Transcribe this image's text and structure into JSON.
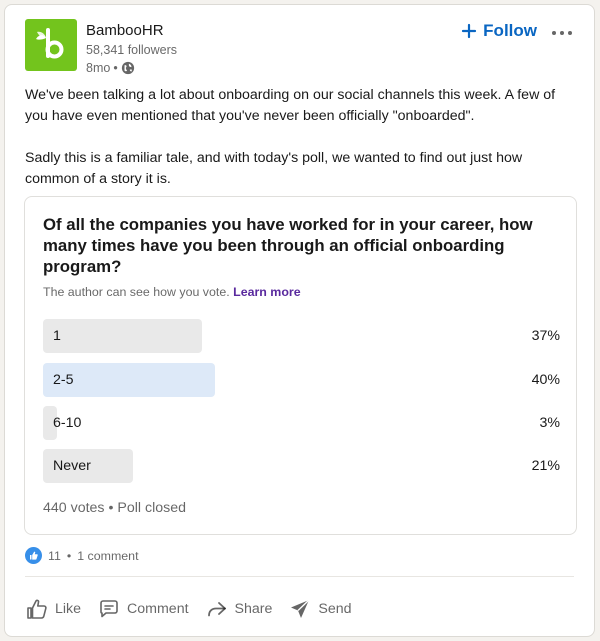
{
  "post": {
    "author_name": "BambooHR",
    "followers": "58,341 followers",
    "time": "8mo",
    "visibility_separator": "•",
    "follow_label": "Follow",
    "body": [
      "We've been talking a lot about onboarding on our social channels this week. A few of you have even mentioned that you've never been officially \"onboarded\".",
      "Sadly this is a familiar tale, and with today's poll, we wanted to find out just how common of a story it is."
    ]
  },
  "poll": {
    "question": "Of all the companies you have worked for in your career, how many times have you been through an official onboarding program?",
    "note": "The author can see how you vote.",
    "learn_more": "Learn more",
    "options": [
      {
        "label": "1",
        "percent_label": "37%",
        "percent": 37,
        "selected": false
      },
      {
        "label": "2-5",
        "percent_label": "40%",
        "percent": 40,
        "selected": true
      },
      {
        "label": "6-10",
        "percent_label": "3%",
        "percent": 3,
        "selected": false
      },
      {
        "label": "Never",
        "percent_label": "21%",
        "percent": 21,
        "selected": false
      }
    ],
    "footer": "440 votes • Poll closed"
  },
  "social": {
    "reactions": "11",
    "separator": "•",
    "comments": "1 comment"
  },
  "actions": {
    "like": "Like",
    "comment": "Comment",
    "share": "Share",
    "send": "Send"
  },
  "colors": {
    "brand": "#73c41d",
    "accent": "#0a66c2",
    "selected_bar": "#dde9f8",
    "bar": "#e9e9e9"
  },
  "icons": [
    "bamboohr-logo",
    "globe-icon",
    "plus-icon",
    "more-icon",
    "like-reaction-icon",
    "like-icon",
    "comment-icon",
    "share-icon",
    "send-icon"
  ]
}
